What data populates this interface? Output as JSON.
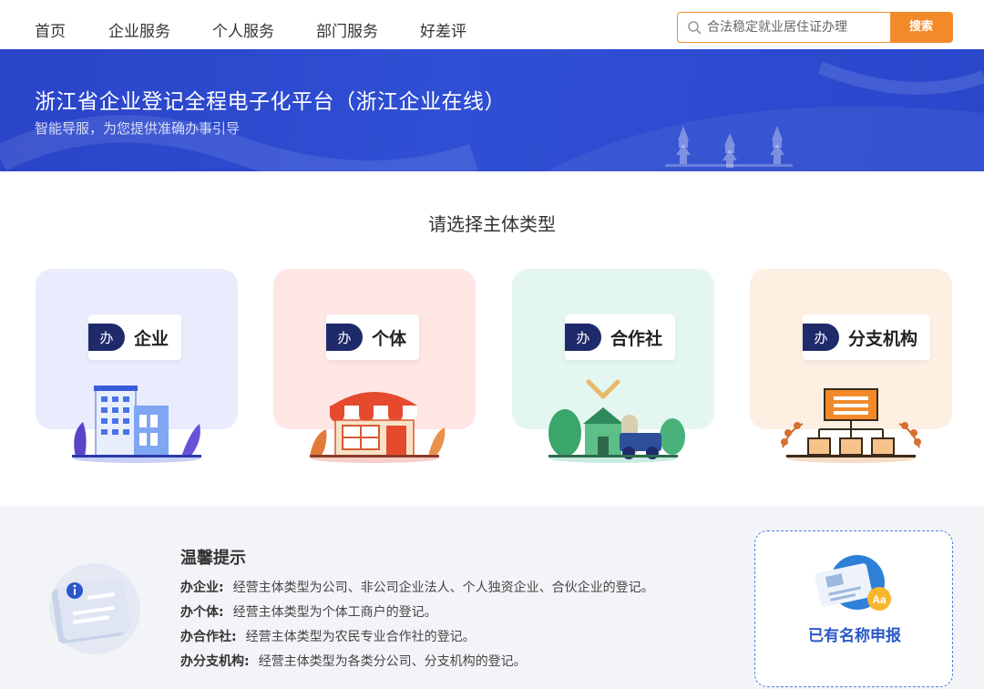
{
  "nav": {
    "items": [
      "首页",
      "企业服务",
      "个人服务",
      "部门服务",
      "好差评"
    ]
  },
  "search": {
    "placeholder": "合法稳定就业居住证办理",
    "button": "搜索"
  },
  "banner": {
    "title": "浙江省企业登记全程电子化平台（浙江企业在线）",
    "subtitle": "智能导服，为您提供准确办事引导"
  },
  "section": {
    "title": "请选择主体类型"
  },
  "cards": [
    {
      "tag": "办",
      "name": "企业",
      "icon": "office-building-icon",
      "color": "#e9ecfd"
    },
    {
      "tag": "办",
      "name": "个体",
      "icon": "storefront-icon",
      "color": "#fde6e4"
    },
    {
      "tag": "办",
      "name": "合作社",
      "icon": "farm-windmill-tractor-icon",
      "color": "#e4f6f0"
    },
    {
      "tag": "办",
      "name": "分支机构",
      "icon": "org-chart-icon",
      "color": "#fdefe2"
    }
  ],
  "tips": {
    "title": "温馨提示",
    "lines": [
      {
        "key": "办企业:",
        "text": "经营主体类型为公司、非公司企业法人、个人独资企业、合伙企业的登记。"
      },
      {
        "key": "办个体:",
        "text": "经营主体类型为个体工商户的登记。"
      },
      {
        "key": "办合作社:",
        "text": "经营主体类型为农民专业合作社的登记。"
      },
      {
        "key": "办分支机构:",
        "text": "经营主体类型为各类分公司、分支机构的登记。"
      }
    ]
  },
  "named": {
    "label": "已有名称申报"
  },
  "colors": {
    "banner": "#2f4fd4",
    "accent": "#f28a2a",
    "tag": "#1f2a6b",
    "link": "#2b58c8"
  }
}
